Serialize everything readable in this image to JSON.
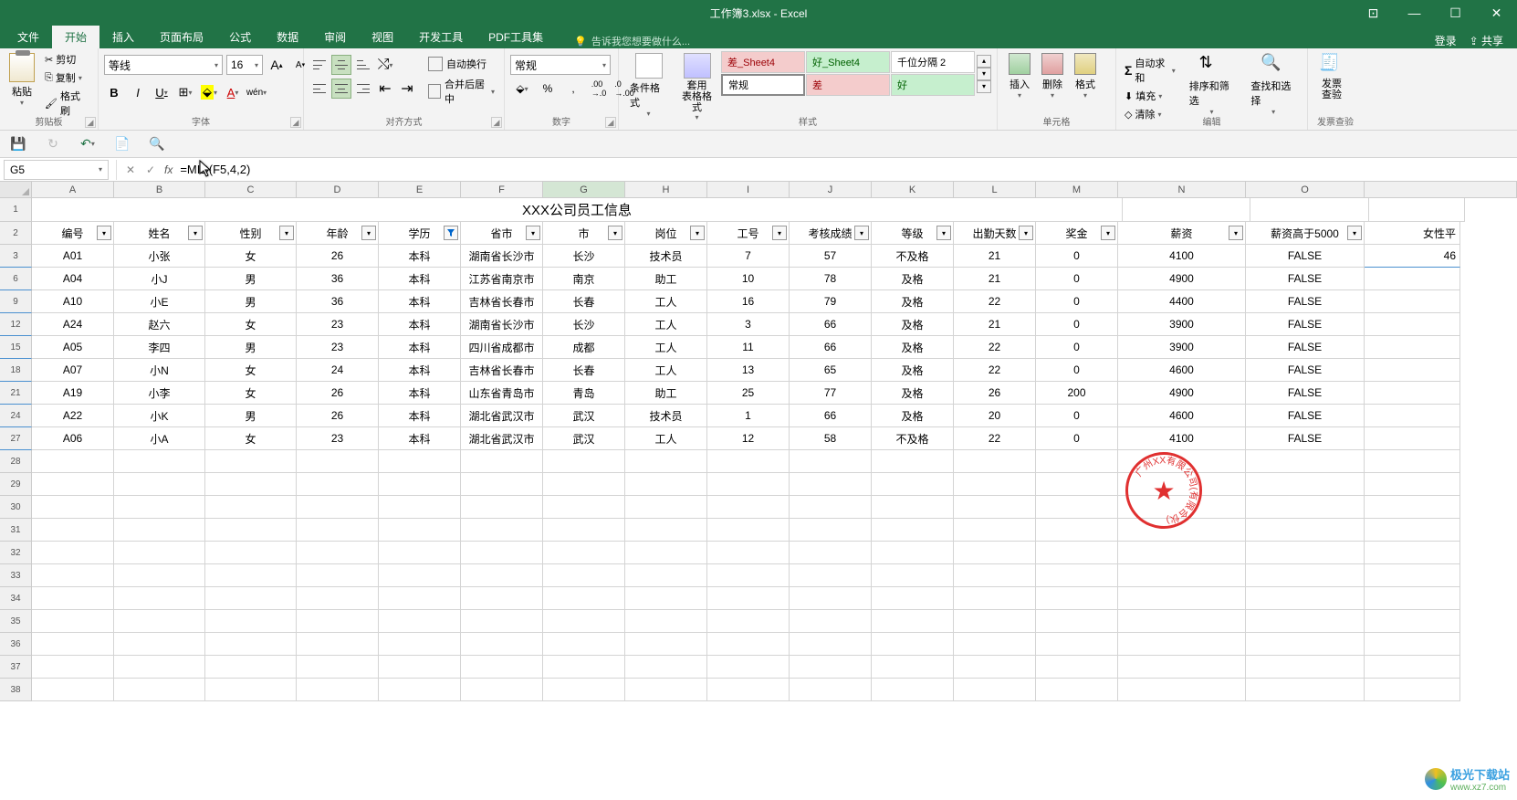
{
  "titlebar": {
    "title": "工作簿3.xlsx - Excel"
  },
  "window_buttons": {
    "options": "⊡",
    "min": "—",
    "max": "☐",
    "close": "✕"
  },
  "ribbon_tabs": [
    "文件",
    "开始",
    "插入",
    "页面布局",
    "公式",
    "数据",
    "审阅",
    "视图",
    "开发工具",
    "PDF工具集"
  ],
  "active_tab_index": 1,
  "tellme": {
    "bulb": "💡",
    "text": "告诉我您想要做什么..."
  },
  "login_label": "登录",
  "share_label": "共享",
  "clipboard": {
    "paste": "粘贴",
    "cut": "剪切",
    "copy": "复制",
    "format_painter": "格式刷",
    "group": "剪贴板"
  },
  "font": {
    "name": "等线",
    "size": "16",
    "bold": "B",
    "italic": "I",
    "underline": "U",
    "increase": "A",
    "decrease": "A",
    "group": "字体"
  },
  "alignment": {
    "wrap": "自动换行",
    "merge": "合并后居中",
    "group": "对齐方式"
  },
  "number": {
    "format": "常规",
    "group": "数字",
    "currency": "⬙",
    "percent": "%",
    "comma": ",",
    "inc_dec": "←0",
    "dec_dec": "→0"
  },
  "styles": {
    "cond": "条件格式",
    "table": "套用\n表格格式",
    "cell1": "差_Sheet4",
    "cell2": "好_Sheet4",
    "cell3": "千位分隔 2",
    "cell4": "常规",
    "cell5": "差",
    "cell6": "好",
    "group": "样式"
  },
  "cells": {
    "insert": "插入",
    "delete": "删除",
    "format": "格式",
    "group": "单元格"
  },
  "editing": {
    "sum": "自动求和",
    "fill": "填充",
    "clear": "清除",
    "sort": "排序和筛选",
    "find": "查找和选择",
    "group": "编辑"
  },
  "invoice": {
    "label": "发票\n查验",
    "group": "发票查验"
  },
  "name_box": "G5",
  "formula": "=MID(F5,4,2)",
  "columns": [
    "A",
    "B",
    "C",
    "D",
    "E",
    "F",
    "G",
    "H",
    "I",
    "J",
    "K",
    "L",
    "M",
    "N",
    "O"
  ],
  "active_col": "G",
  "table_title": "XXX公司员工信息",
  "headers": [
    "编号",
    "姓名",
    "性别",
    "年龄",
    "学历",
    "省市",
    "市",
    "岗位",
    "工号",
    "考核成绩",
    "等级",
    "出勤天数",
    "奖金",
    "薪资",
    "薪资高于5000"
  ],
  "extra_header_right": "女性平",
  "filtered_col_index": 4,
  "row_numbers_visible": [
    "1",
    "2",
    "3",
    "6",
    "9",
    "12",
    "15",
    "18",
    "21",
    "24",
    "27",
    "28",
    "29",
    "30",
    "31",
    "32",
    "33",
    "34",
    "35",
    "36",
    "37",
    "38"
  ],
  "rows": [
    [
      "A01",
      "小张",
      "女",
      "26",
      "本科",
      "湖南省长沙市",
      "长沙",
      "技术员",
      "7",
      "57",
      "不及格",
      "21",
      "0",
      "4100",
      "FALSE"
    ],
    [
      "A04",
      "小J",
      "男",
      "36",
      "本科",
      "江苏省南京市",
      "南京",
      "助工",
      "10",
      "78",
      "及格",
      "21",
      "0",
      "4900",
      "FALSE"
    ],
    [
      "A10",
      "小E",
      "男",
      "36",
      "本科",
      "吉林省长春市",
      "长春",
      "工人",
      "16",
      "79",
      "及格",
      "22",
      "0",
      "4400",
      "FALSE"
    ],
    [
      "A24",
      "赵六",
      "女",
      "23",
      "本科",
      "湖南省长沙市",
      "长沙",
      "工人",
      "3",
      "66",
      "及格",
      "21",
      "0",
      "3900",
      "FALSE"
    ],
    [
      "A05",
      "李四",
      "男",
      "23",
      "本科",
      "四川省成都市",
      "成都",
      "工人",
      "11",
      "66",
      "及格",
      "22",
      "0",
      "3900",
      "FALSE"
    ],
    [
      "A07",
      "小N",
      "女",
      "24",
      "本科",
      "吉林省长春市",
      "长春",
      "工人",
      "13",
      "65",
      "及格",
      "22",
      "0",
      "4600",
      "FALSE"
    ],
    [
      "A19",
      "小李",
      "女",
      "26",
      "本科",
      "山东省青岛市",
      "青岛",
      "助工",
      "25",
      "77",
      "及格",
      "26",
      "200",
      "4900",
      "FALSE"
    ],
    [
      "A22",
      "小K",
      "男",
      "26",
      "本科",
      "湖北省武汉市",
      "武汉",
      "技术员",
      "1",
      "66",
      "及格",
      "20",
      "0",
      "4600",
      "FALSE"
    ],
    [
      "A06",
      "小A",
      "女",
      "23",
      "本科",
      "湖北省武汉市",
      "武汉",
      "工人",
      "12",
      "58",
      "不及格",
      "22",
      "0",
      "4100",
      "FALSE"
    ]
  ],
  "extra_right_value": "46",
  "stamp_text": "广州XX有限公司(有限合伙)",
  "watermark": {
    "brand": "极光下载站",
    "url": "www.xz7.com"
  }
}
